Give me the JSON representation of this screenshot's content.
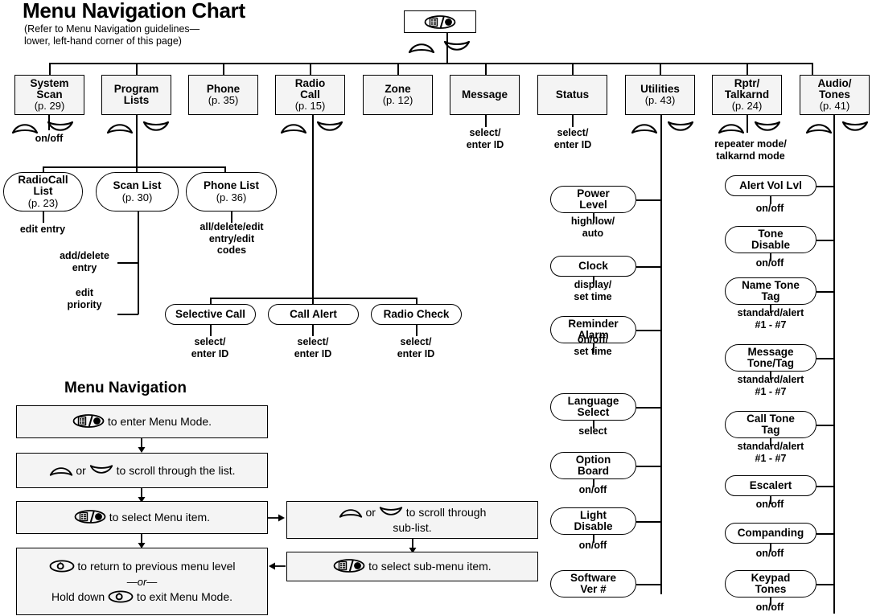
{
  "doc": {
    "title": "Menu Navigation Chart",
    "subtitle": "(Refer to Menu Navigation guidelines—\nlower, left-hand corner of this page)",
    "nav_title": "Menu Navigation"
  },
  "root": {
    "icon": "menu-select-key-icon"
  },
  "top_menus": [
    {
      "name": "System\nScan",
      "page": "(p. 29)",
      "keys": [
        "up-key-icon",
        "down-key-icon"
      ],
      "option": "on/off"
    },
    {
      "name": "Program\nLists",
      "page": "",
      "keys": [
        "up-key-icon",
        "down-key-icon"
      ],
      "option": ""
    },
    {
      "name": "Phone",
      "page": "(p. 35)",
      "keys": [],
      "option": ""
    },
    {
      "name": "Radio\nCall",
      "page": "(p. 15)",
      "keys": [
        "up-key-icon",
        "down-key-icon"
      ],
      "option": ""
    },
    {
      "name": "Zone",
      "page": "(p. 12)",
      "keys": [],
      "option": ""
    },
    {
      "name": "Message",
      "page": "",
      "keys": [],
      "option": "select/\nenter ID"
    },
    {
      "name": "Status",
      "page": "",
      "keys": [],
      "option": "select/\nenter ID"
    },
    {
      "name": "Utilities",
      "page": "(p. 43)",
      "keys": [
        "up-key-icon",
        "down-key-icon"
      ],
      "option": ""
    },
    {
      "name": "Rptr/\nTalkarnd",
      "page": "(p. 24)",
      "keys": [
        "up-key-icon",
        "down-key-icon"
      ],
      "option": "repeater mode/\ntalkarnd mode"
    },
    {
      "name": "Audio/\nTones",
      "page": "(p. 41)",
      "keys": [
        "up-key-icon",
        "down-key-icon"
      ],
      "option": ""
    }
  ],
  "program_lists_children": [
    {
      "name": "RadioCall\nList",
      "page": "(p. 23)",
      "option": "edit entry"
    },
    {
      "name": "Scan List",
      "page": "(p. 30)",
      "option": ""
    },
    {
      "name": "Phone List",
      "page": "(p. 36)",
      "option": "all/delete/edit\nentry/edit\ncodes"
    }
  ],
  "scan_list_options": [
    "add/delete\nentry",
    "edit\npriority"
  ],
  "radio_call_children": [
    {
      "name": "Selective Call",
      "option": "select/\nenter ID"
    },
    {
      "name": "Call Alert",
      "option": "select/\nenter ID"
    },
    {
      "name": "Radio Check",
      "option": "select/\nenter ID"
    }
  ],
  "utilities_children": [
    {
      "name": "Power\nLevel",
      "option": "high/low/\nauto"
    },
    {
      "name": "Clock",
      "option": "display/\nset time"
    },
    {
      "name": "Reminder\nAlarm",
      "option": "on/off/\nset time"
    },
    {
      "name": "Language\nSelect",
      "option": "select"
    },
    {
      "name": "Option\nBoard",
      "option": "on/off"
    },
    {
      "name": "Light\nDisable",
      "option": "on/off"
    },
    {
      "name": "Software\nVer #",
      "option": ""
    }
  ],
  "audio_tones_children": [
    {
      "name": "Alert Vol Lvl",
      "option": "on/off"
    },
    {
      "name": "Tone\nDisable",
      "option": "on/off"
    },
    {
      "name": "Name Tone\nTag",
      "option": "standard/alert\n#1 - #7"
    },
    {
      "name": "Message\nTone/Tag",
      "option": "standard/alert\n#1 - #7"
    },
    {
      "name": "Call Tone\nTag",
      "option": "standard/alert\n#1 - #7"
    },
    {
      "name": "Escalert",
      "option": "on/off"
    },
    {
      "name": "Companding",
      "option": "on/off"
    },
    {
      "name": "Keypad\nTones",
      "option": "on/off"
    }
  ],
  "legend": {
    "step1_text": " to enter Menu Mode.",
    "step2_mid": " or ",
    "step2_text": " to scroll through the list.",
    "step3_text": " to select Menu item.",
    "step4_a": " to return to previous menu level",
    "step4_or": "—or—",
    "step4_b_pre": "Hold down ",
    "step4_b_post": " to exit Menu Mode.",
    "sub1_mid": " or ",
    "sub1_text": " to scroll through\nsub-list.",
    "sub2_text": " to select sub-menu item."
  },
  "colors": {
    "line": "#000000",
    "rect_fill": "#f4f4f4",
    "pill_fill": "#ffffff"
  }
}
